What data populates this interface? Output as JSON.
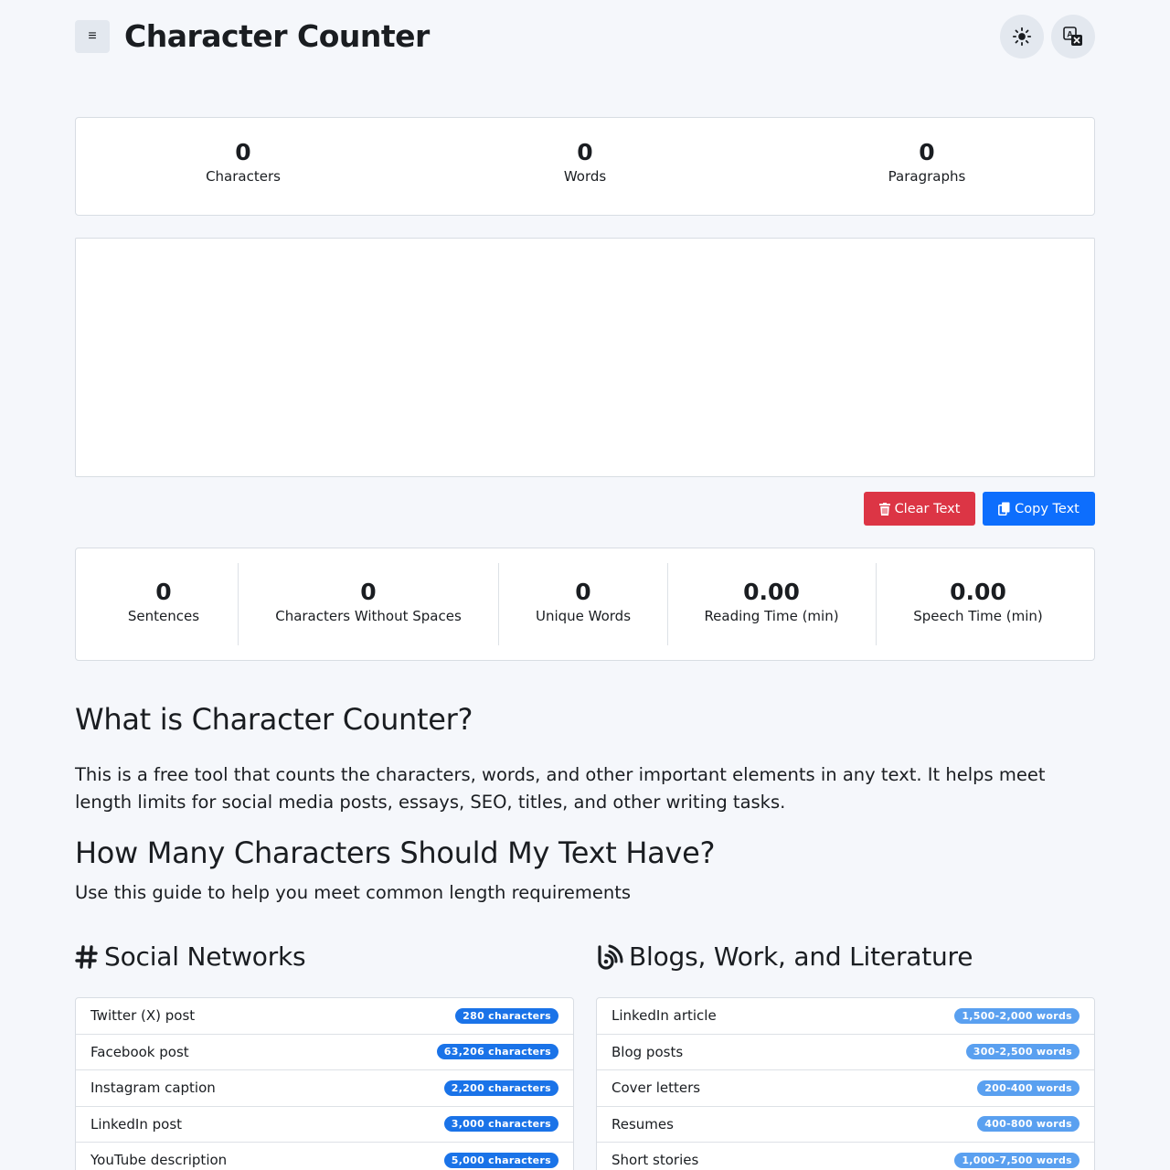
{
  "header": {
    "menu_glyph": "≡",
    "title": "Character Counter"
  },
  "stats_top": [
    {
      "value": "0",
      "label": "Characters"
    },
    {
      "value": "0",
      "label": "Words"
    },
    {
      "value": "0",
      "label": "Paragraphs"
    }
  ],
  "editor": {
    "value": "",
    "placeholder": ""
  },
  "actions": {
    "clear_label": "Clear Text",
    "copy_label": "Copy Text",
    "clear_color": "#dc3545",
    "copy_color": "#0d6efd"
  },
  "stats_bottom": [
    {
      "value": "0",
      "label": "Sentences"
    },
    {
      "value": "0",
      "label": "Characters Without Spaces"
    },
    {
      "value": "0",
      "label": "Unique Words"
    },
    {
      "value": "0.00",
      "label": "Reading Time (min)"
    },
    {
      "value": "0.00",
      "label": "Speech Time (min)"
    }
  ],
  "about": {
    "heading": "What is Character Counter?",
    "body": "This is a free tool that counts the characters, words, and other important elements in any text. It helps meet length limits for social media posts, essays, SEO, titles, and other writing tasks."
  },
  "guide": {
    "heading": "How Many Characters Should My Text Have?",
    "subtitle": "Use this guide to help you meet common length requirements"
  },
  "social": {
    "heading": "Social Networks",
    "icon": "hashtag-icon",
    "items": [
      {
        "label": "Twitter (X) post",
        "badge": "280 characters"
      },
      {
        "label": "Facebook post",
        "badge": "63,206 characters"
      },
      {
        "label": "Instagram caption",
        "badge": "2,200 characters"
      },
      {
        "label": "LinkedIn post",
        "badge": "3,000 characters"
      },
      {
        "label": "YouTube description",
        "badge": "5,000 characters"
      }
    ]
  },
  "blogs": {
    "heading": "Blogs, Work, and Literature",
    "icon": "blog-icon",
    "items": [
      {
        "label": "LinkedIn article",
        "badge": "1,500-2,000 words"
      },
      {
        "label": "Blog posts",
        "badge": "300-2,500 words"
      },
      {
        "label": "Cover letters",
        "badge": "200-400 words"
      },
      {
        "label": "Resumes",
        "badge": "400-800 words"
      },
      {
        "label": "Short stories",
        "badge": "1,000-7,500 words"
      }
    ]
  }
}
